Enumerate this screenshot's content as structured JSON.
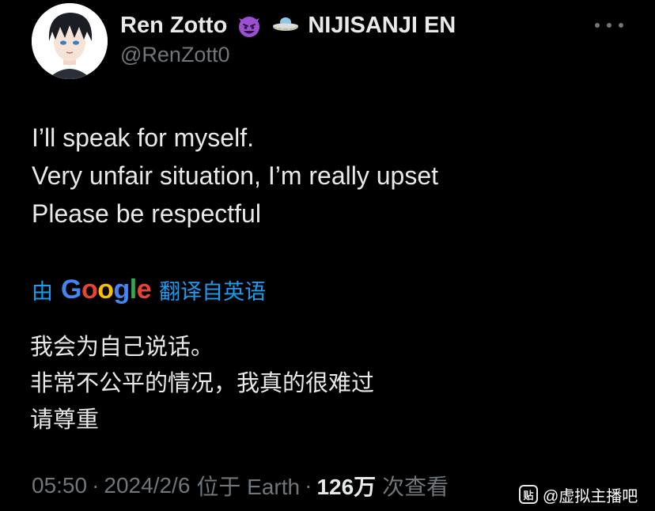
{
  "author": {
    "display_name": "Ren Zotto",
    "emoji_1": "smiling-devil-icon",
    "emoji_2": "ufo-icon",
    "suffix": "NIJISANJI EN",
    "handle": "@RenZott0"
  },
  "more_button": "more-options-icon",
  "tweet": {
    "lines": [
      "I’ll speak for myself.",
      "Very unfair situation, I’m really upset",
      "Please be respectful"
    ]
  },
  "translation": {
    "prefix": "由",
    "logo_letters": [
      "G",
      "o",
      "o",
      "g",
      "l",
      "e"
    ],
    "suffix": "翻译自英语",
    "lines": [
      "我会为自己说话。",
      "非常不公平的情况，我真的很难过",
      "请尊重"
    ]
  },
  "meta": {
    "time": "05:50",
    "date": "2024/2/6",
    "location": "位于 Earth",
    "separator": "·",
    "views_count": "126万",
    "views_label": "次查看"
  },
  "watermark": {
    "logo_text": "贴",
    "text": "@虚拟主播吧"
  },
  "colors": {
    "background": "#000000",
    "text": "#e7e9ea",
    "secondary": "#71767b",
    "accent": "#1d9bf0"
  }
}
